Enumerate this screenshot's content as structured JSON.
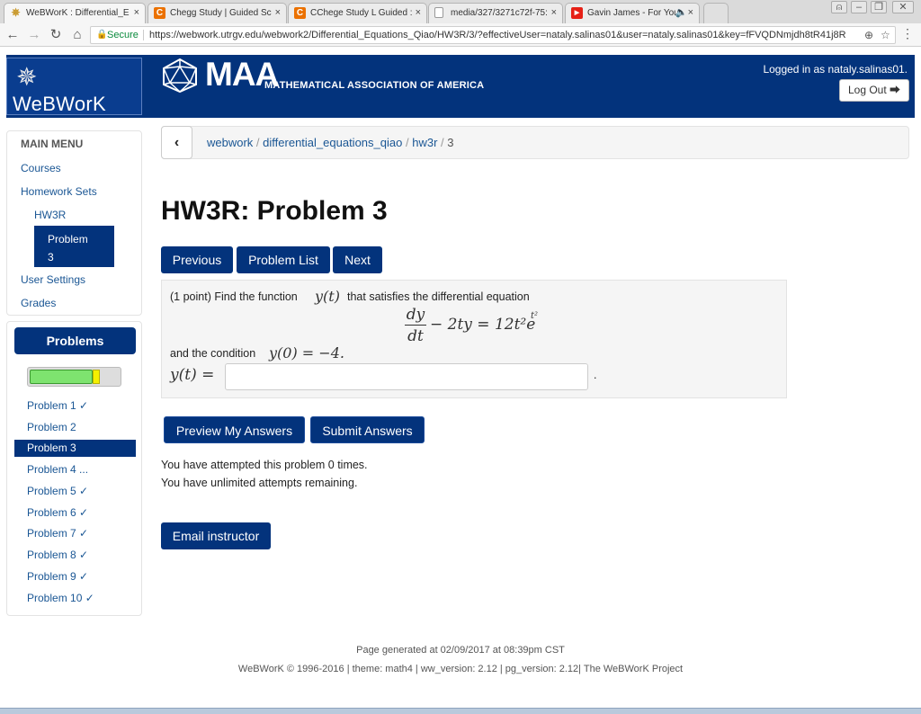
{
  "browser": {
    "tabs": [
      {
        "title": "WeBWorK : Differential_E",
        "icon": "webwork-favicon"
      },
      {
        "title": "Chegg Study | Guided Sc",
        "icon": "chegg-favicon"
      },
      {
        "title": "CChege Study L Guided :",
        "icon": "chegg-favicon"
      },
      {
        "title": "media/327/3271c72f-75:",
        "icon": "page-favicon"
      },
      {
        "title": "Gavin James - For You",
        "icon": "youtube-favicon"
      }
    ],
    "secure_label": "Secure",
    "url": "https://webwork.utrgv.edu/webwork2/Differential_Equations_Qiao/HW3R/3/?effectiveUser=nataly.salinas01&user=nataly.salinas01&key=fFVQDNmjdh8tR41j8R"
  },
  "header": {
    "app_name": "WeBWorK",
    "maa_letters": "MAA",
    "maa_subtitle": "MATHEMATICAL ASSOCIATION OF AMERICA",
    "logged_in": "Logged in as nataly.salinas01.",
    "logout_label": "Log Out"
  },
  "sidebar": {
    "menu_title": "MAIN MENU",
    "courses": "Courses",
    "homework_sets": "Homework Sets",
    "hw3r": "HW3R",
    "problem_active_line1": "Problem",
    "problem_active_line2": "3",
    "user_settings": "User Settings",
    "grades": "Grades",
    "problems_button": "Problems",
    "progress_fraction": 0.75,
    "problems": [
      "Problem 1 ✓",
      "Problem 2",
      "Problem 3",
      "Problem 4 ...",
      "Problem 5 ✓",
      "Problem 6 ✓",
      "Problem 7 ✓",
      "Problem 8 ✓",
      "Problem 9 ✓",
      "Problem 10 ✓"
    ]
  },
  "breadcrumb": {
    "webwork": "webwork",
    "course": "differential_equations_qiao",
    "set": "hw3r",
    "current": "3",
    "separator": "/"
  },
  "main": {
    "title": "HW3R: Problem 3",
    "previous": "Previous",
    "problem_list": "Problem List",
    "next": "Next",
    "problem_intro": "(1 point) Find the function",
    "problem_fn": "y(t)",
    "problem_intro_end": "that satisfies the differential equation",
    "ode_num": "dy",
    "ode_den": "dt",
    "ode_rhs": "− 2ty = 12t²e",
    "ode_exp": "t²",
    "condition_text": "and the condition",
    "condition_math": "y(0) = −4.",
    "answer_label": "y(t) =",
    "answer_value": "",
    "answer_trailing": ".",
    "preview_label": "Preview My Answers",
    "submit_label": "Submit Answers",
    "attempts_text": "You have attempted this problem 0 times.",
    "remaining_text": "You have unlimited attempts remaining.",
    "email_label": "Email instructor"
  },
  "footer": {
    "generated": "Page generated at 02/09/2017 at 08:39pm CST",
    "copyright": "WeBWorK © 1996-2016 | theme: math4 | ww_version: 2.12 | pg_version: 2.12| The WeBWorK Project"
  }
}
